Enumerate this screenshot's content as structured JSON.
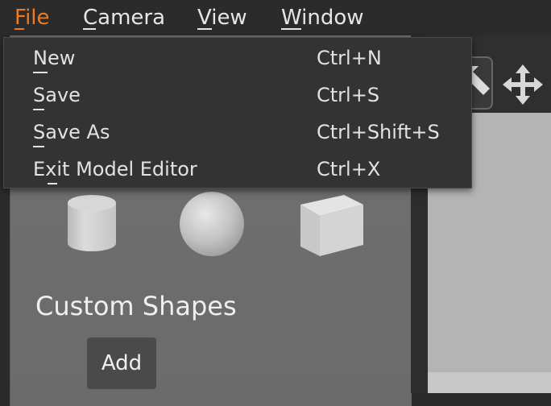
{
  "menubar": {
    "items": [
      {
        "label": "File",
        "active": true
      },
      {
        "label": "Camera"
      },
      {
        "label": "View"
      },
      {
        "label": "Window"
      }
    ]
  },
  "file_menu": {
    "items": [
      {
        "label": "New",
        "shortcut": "Ctrl+N"
      },
      {
        "label": "Save",
        "shortcut": "Ctrl+S"
      },
      {
        "label": "Save As",
        "shortcut": "Ctrl+Shift+S"
      },
      {
        "label": "Exit Model Editor",
        "shortcut": "Ctrl+X"
      }
    ]
  },
  "shapes_panel": {
    "primitives": [
      "cylinder-icon",
      "sphere-icon",
      "cube-icon"
    ],
    "custom_title": "Custom Shapes",
    "add_label": "Add"
  },
  "viewport_toolbar": {
    "tools": [
      "select-arrow-icon",
      "move-icon"
    ]
  },
  "colors": {
    "menubar_bg": "#2b2b2b",
    "menubar_active": "#f07a21",
    "dropdown_bg": "#333333",
    "panel_bg": "#707070",
    "viewport_bg": "#b4b4b4"
  }
}
